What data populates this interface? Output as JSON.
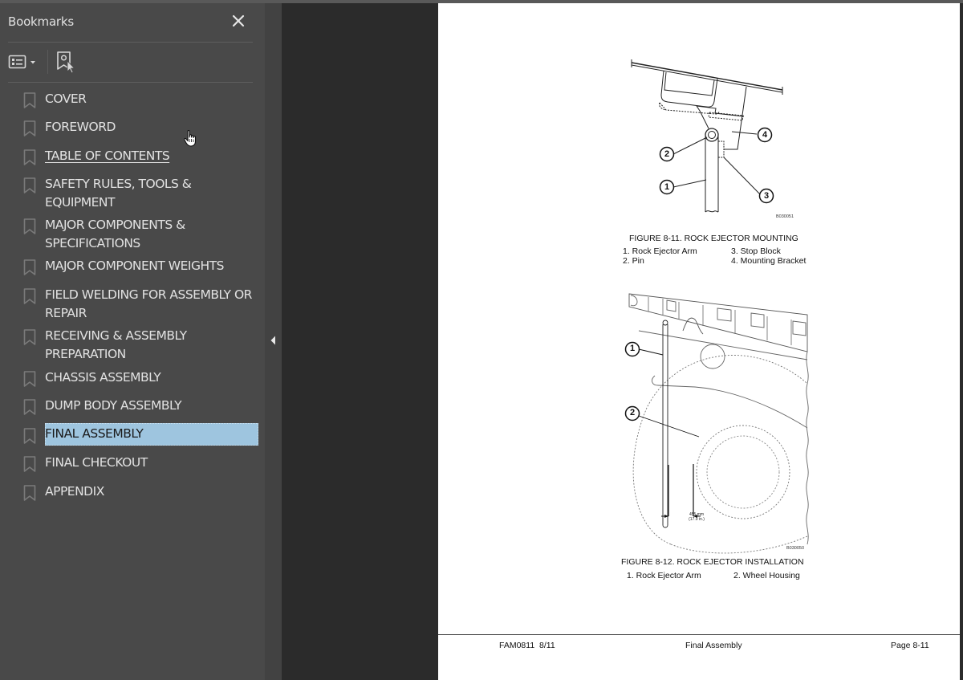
{
  "bookmarks_panel": {
    "title": "Bookmarks",
    "close_icon": "close-icon",
    "options_icon": "list-options-icon",
    "new_bookmark_icon": "new-bookmark-icon",
    "items": [
      {
        "label": "COVER",
        "state": "normal"
      },
      {
        "label": "FOREWORD",
        "state": "normal"
      },
      {
        "label": "TABLE OF CONTENTS",
        "state": "hover"
      },
      {
        "label": "SAFETY RULES, TOOLS & EQUIPMENT",
        "state": "normal"
      },
      {
        "label": "MAJOR COMPONENTS & SPECIFICATIONS",
        "state": "normal"
      },
      {
        "label": "MAJOR COMPONENT WEIGHTS",
        "state": "normal"
      },
      {
        "label": "FIELD WELDING FOR ASSEMBLY OR REPAIR",
        "state": "normal"
      },
      {
        "label": "RECEIVING & ASSEMBLY PREPARATION",
        "state": "normal"
      },
      {
        "label": "CHASSIS ASSEMBLY",
        "state": "normal"
      },
      {
        "label": "DUMP BODY ASSEMBLY",
        "state": "normal"
      },
      {
        "label": "FINAL ASSEMBLY",
        "state": "selected"
      },
      {
        "label": "FINAL CHECKOUT",
        "state": "normal"
      },
      {
        "label": "APPENDIX",
        "state": "normal"
      }
    ],
    "selected_color": "#9ec5df"
  },
  "page": {
    "figure1": {
      "caption": "FIGURE 8-11. ROCK EJECTOR MOUNTING",
      "code": "B030051",
      "callouts": [
        "1",
        "2",
        "3",
        "4"
      ],
      "legend": [
        "1. Rock Ejector Arm",
        "2. Pin",
        "3. Stop Block",
        "4. Mounting Bracket"
      ]
    },
    "figure2": {
      "caption": "FIGURE 8-12. ROCK EJECTOR INSTALLATION",
      "code": "B030050",
      "callouts": [
        "1",
        "2"
      ],
      "dimension_mm": "455 mm",
      "dimension_in": "(17.9 in.)",
      "legend": [
        "1. Rock Ejector Arm",
        "2. Wheel Housing"
      ]
    },
    "footer": {
      "doc_id": "FAM0811  8/11",
      "section": "Final Assembly",
      "page_number": "Page 8-11"
    }
  }
}
